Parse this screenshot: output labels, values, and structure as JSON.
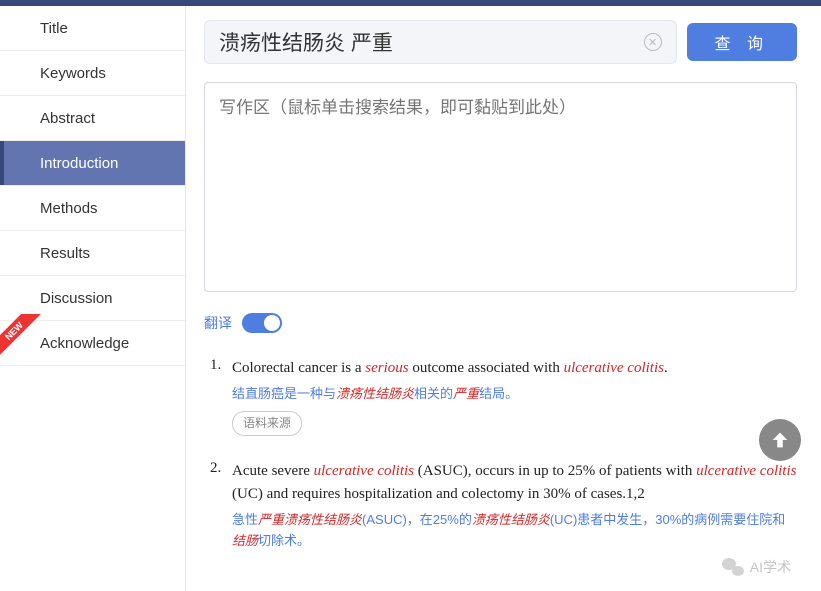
{
  "sidebar": {
    "items": [
      {
        "label": "Title",
        "active": false
      },
      {
        "label": "Keywords",
        "active": false
      },
      {
        "label": "Abstract",
        "active": false
      },
      {
        "label": "Introduction",
        "active": true
      },
      {
        "label": "Methods",
        "active": false
      },
      {
        "label": "Results",
        "active": false
      },
      {
        "label": "Discussion",
        "active": false
      },
      {
        "label": "Acknowledge",
        "active": false
      }
    ],
    "new_badge": "NEW"
  },
  "search": {
    "value": "溃疡性结肠炎 严重",
    "query_btn": "查 询"
  },
  "write_area": {
    "placeholder": "写作区（鼠标单击搜索结果，即可黏贴到此处）"
  },
  "translate": {
    "label": "翻译",
    "on": true
  },
  "results": [
    {
      "num": "1.",
      "en_html": "Colorectal cancer is a <em>serious</em> outcome associated with <em>ulcerative colitis</em>.",
      "zh_html": "结直肠癌是一种与<em>溃疡性结肠炎</em>相关的<em>严重</em>结局。",
      "source_label": "语料来源"
    },
    {
      "num": "2.",
      "en_html": "Acute severe <em>ulcerative colitis</em> (ASUC), occurs in up to 25% of patients with <em>ulcerative colitis</em> (UC) and requires hospitalization and colectomy in 30% of cases.1,2",
      "zh_html": "急性<em>严重溃疡性结肠炎</em>(ASUC)，在25%的<em>溃疡性结肠炎</em>(UC)患者中发生，30%的病例需要住院和<em>结肠</em>切除术。",
      "source_label": ""
    }
  ],
  "watermark": "AI学术"
}
